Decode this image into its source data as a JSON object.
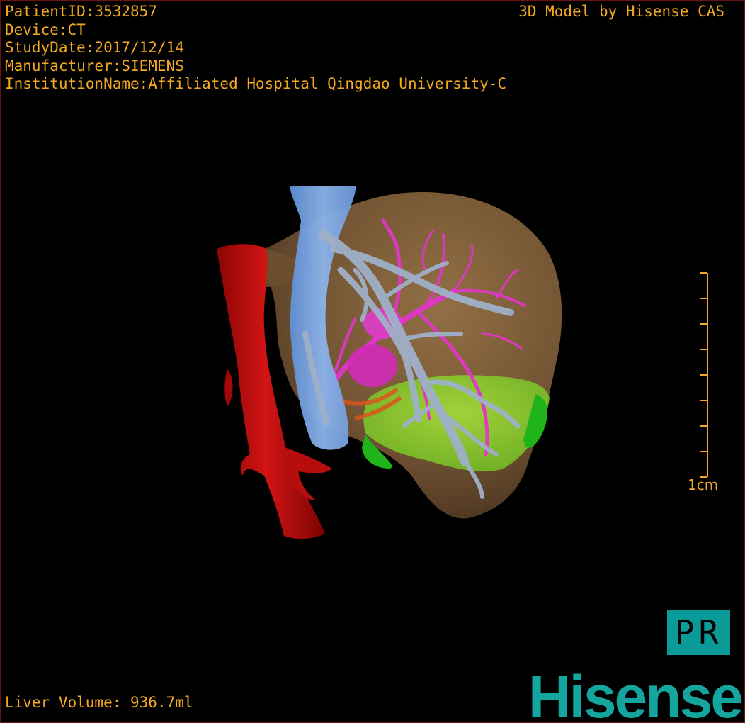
{
  "header": {
    "patient_id": "PatientID:3532857",
    "device": "Device:CT",
    "study_date": "StudyDate:2017/12/14",
    "manufacturer": "Manufacturer:SIEMENS",
    "institution": "InstitutionName:Affiliated Hospital Qingdao University-C",
    "vendor": "3D Model by Hisense CAS"
  },
  "scale": {
    "label": "1cm",
    "tick_count": 9
  },
  "footer": {
    "liver_volume": "Liver Volume:  936.7ml"
  },
  "orientation": "PR",
  "brand": "Hisense",
  "model": {
    "structures": [
      "liver",
      "inferior-vena-cava",
      "aorta",
      "portal-vein",
      "hepatic-vein",
      "lesion",
      "gallbladder-region"
    ],
    "colors": {
      "liver": "#7a5a37",
      "aorta": "#c20a0a",
      "ivc": "#7ca7e0",
      "hepatic_vein": "#9fb0c8",
      "portal_vein": "#e236c8",
      "region": "#8fd02a",
      "region_dark": "#1fb41a",
      "overlay_text": "#f3a91f",
      "brand": "#14a59f"
    }
  }
}
